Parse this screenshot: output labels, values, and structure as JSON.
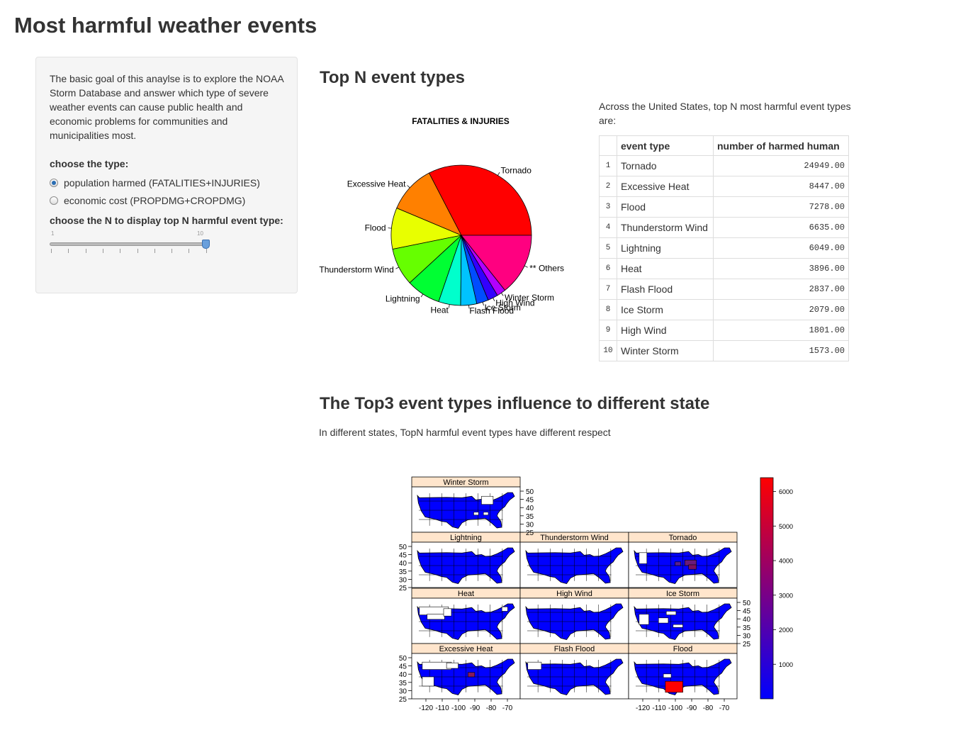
{
  "page": {
    "title": "Most harmful weather events"
  },
  "sidebar": {
    "intro": "The basic goal of this anaylse is to explore the NOAA Storm Database and answer which type of severe weather events can cause public health and economic problems for communities and municipalities most.",
    "type_label": "choose the type:",
    "options": [
      {
        "label": "population harmed (FATALITIES+INJURIES)",
        "selected": true
      },
      {
        "label": "economic cost (PROPDMG+CROPDMG)",
        "selected": false
      }
    ],
    "n_label": "choose the N to display top N harmful event type:",
    "slider": {
      "min": "1",
      "max": "10",
      "value": 10
    }
  },
  "top_n": {
    "heading": "Top N event types",
    "description": "Across the United States, top N most harmful event types are:",
    "table": {
      "headers": [
        "",
        "event type",
        "number of harmed human"
      ],
      "rows": [
        [
          "1",
          "Tornado",
          "24949.00"
        ],
        [
          "2",
          "Excessive Heat",
          "8447.00"
        ],
        [
          "3",
          "Flood",
          "7278.00"
        ],
        [
          "4",
          "Thunderstorm Wind",
          "6635.00"
        ],
        [
          "5",
          "Lightning",
          "6049.00"
        ],
        [
          "6",
          "Heat",
          "3896.00"
        ],
        [
          "7",
          "Flash Flood",
          "2837.00"
        ],
        [
          "8",
          "Ice Storm",
          "2079.00"
        ],
        [
          "9",
          "High Wind",
          "1801.00"
        ],
        [
          "10",
          "Winter Storm",
          "1573.00"
        ]
      ]
    }
  },
  "influence": {
    "heading": "The Top3 event types influence to different state",
    "description": "In different states, TopN harmful event types have different respect"
  },
  "chart_data": [
    {
      "type": "pie",
      "title": "FATALITIES & INJURIES",
      "labels": [
        "Tornado",
        "Excessive Heat",
        "Flood",
        "Thunderstorm Wind",
        "Lightning",
        "Heat",
        "Flash Flood",
        "Ice Storm",
        "High Wind",
        "Winter Storm",
        "** Others"
      ],
      "values": [
        24949,
        8447,
        7278,
        6635,
        6049,
        3896,
        2837,
        2079,
        1801,
        1573,
        10955
      ],
      "colors": [
        "#ff0000",
        "#ff8000",
        "#e8ff00",
        "#66ff00",
        "#00ff33",
        "#00ffcc",
        "#00c3ff",
        "#004dff",
        "#3300ff",
        "#b200ff",
        "#ff0080"
      ]
    },
    {
      "type": "heatmap",
      "panels": [
        "Winter Storm",
        "Lightning",
        "Thunderstorm Wind",
        "Tornado",
        "Heat",
        "High Wind",
        "Ice Storm",
        "Excessive Heat",
        "Flash Flood",
        "Flood"
      ],
      "x_ticks": [
        "-120",
        "-110",
        "-100",
        "-90",
        "-80",
        "-70"
      ],
      "y_ticks": [
        "50",
        "45",
        "40",
        "35",
        "30",
        "25"
      ],
      "colorbar_ticks": [
        "6000",
        "5000",
        "4000",
        "3000",
        "2000",
        "1000"
      ],
      "colorbar_range": [
        0,
        6400
      ],
      "colors": {
        "low": "#0000ff",
        "high": "#ff0000",
        "missing": "#ffffff",
        "strip": "#ffe5cc"
      }
    }
  ]
}
